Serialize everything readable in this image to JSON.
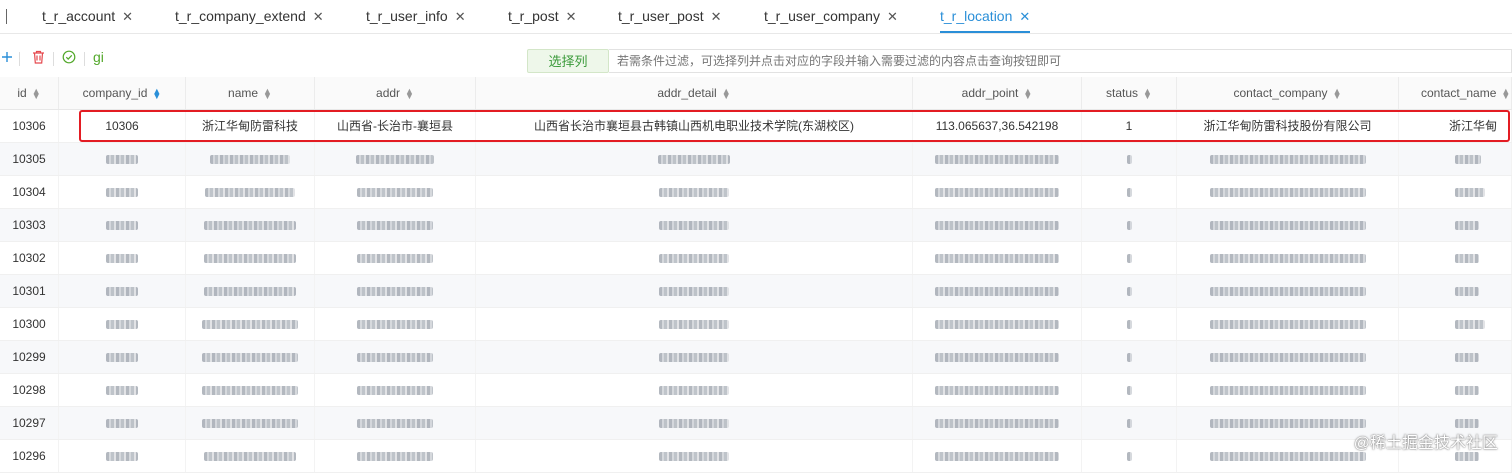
{
  "tabs": [
    {
      "label": "t_r_account",
      "active": false
    },
    {
      "label": "t_r_company_extend",
      "active": false
    },
    {
      "label": "t_r_user_info",
      "active": false
    },
    {
      "label": "t_r_post",
      "active": false
    },
    {
      "label": "t_r_user_post",
      "active": false
    },
    {
      "label": "t_r_user_company",
      "active": false
    },
    {
      "label": "t_r_location",
      "active": true
    }
  ],
  "tab_close_glyph": "✕",
  "toolbar": {
    "add_icon": "plus-icon",
    "delete_icon": "trash-icon",
    "check_icon": "check-circle-icon",
    "gi_label": "gi",
    "choose_columns_label": "选择列",
    "filter_placeholder": "若需条件过滤，可选择列并点击对应的字段并输入需要过滤的内容点击查询按钮即可"
  },
  "table": {
    "columns": [
      "id",
      "company_id",
      "name",
      "addr",
      "addr_detail",
      "addr_point",
      "status",
      "contact_company",
      "contact_name"
    ],
    "sorted_column": "company_id",
    "rows": [
      {
        "id": "10306",
        "company_id": "10306",
        "name": "浙江华甸防雷科技",
        "addr": "山西省-长治市-襄垣县",
        "addr_detail": "山西省长治市襄垣县古韩镇山西机电职业技术学院(东湖校区)",
        "addr_point": "113.065637,36.542198",
        "status": "1",
        "contact_company": "浙江华甸防雷科技股份有限公司",
        "contact_name": "浙江华甸",
        "blurred": false
      },
      {
        "id": "10305",
        "blurred": true
      },
      {
        "id": "10304",
        "blurred": true
      },
      {
        "id": "10303",
        "blurred": true
      },
      {
        "id": "10302",
        "blurred": true
      },
      {
        "id": "10301",
        "blurred": true
      },
      {
        "id": "10300",
        "blurred": true
      },
      {
        "id": "10299",
        "blurred": true
      },
      {
        "id": "10298",
        "blurred": true
      },
      {
        "id": "10297",
        "blurred": true
      },
      {
        "id": "10296",
        "blurred": true
      }
    ]
  },
  "colors": {
    "accent": "#2a8fd8",
    "highlight_border": "#e31c23",
    "choose_button_text": "#3a9a3a"
  },
  "watermark": "@稀土掘金技术社区"
}
